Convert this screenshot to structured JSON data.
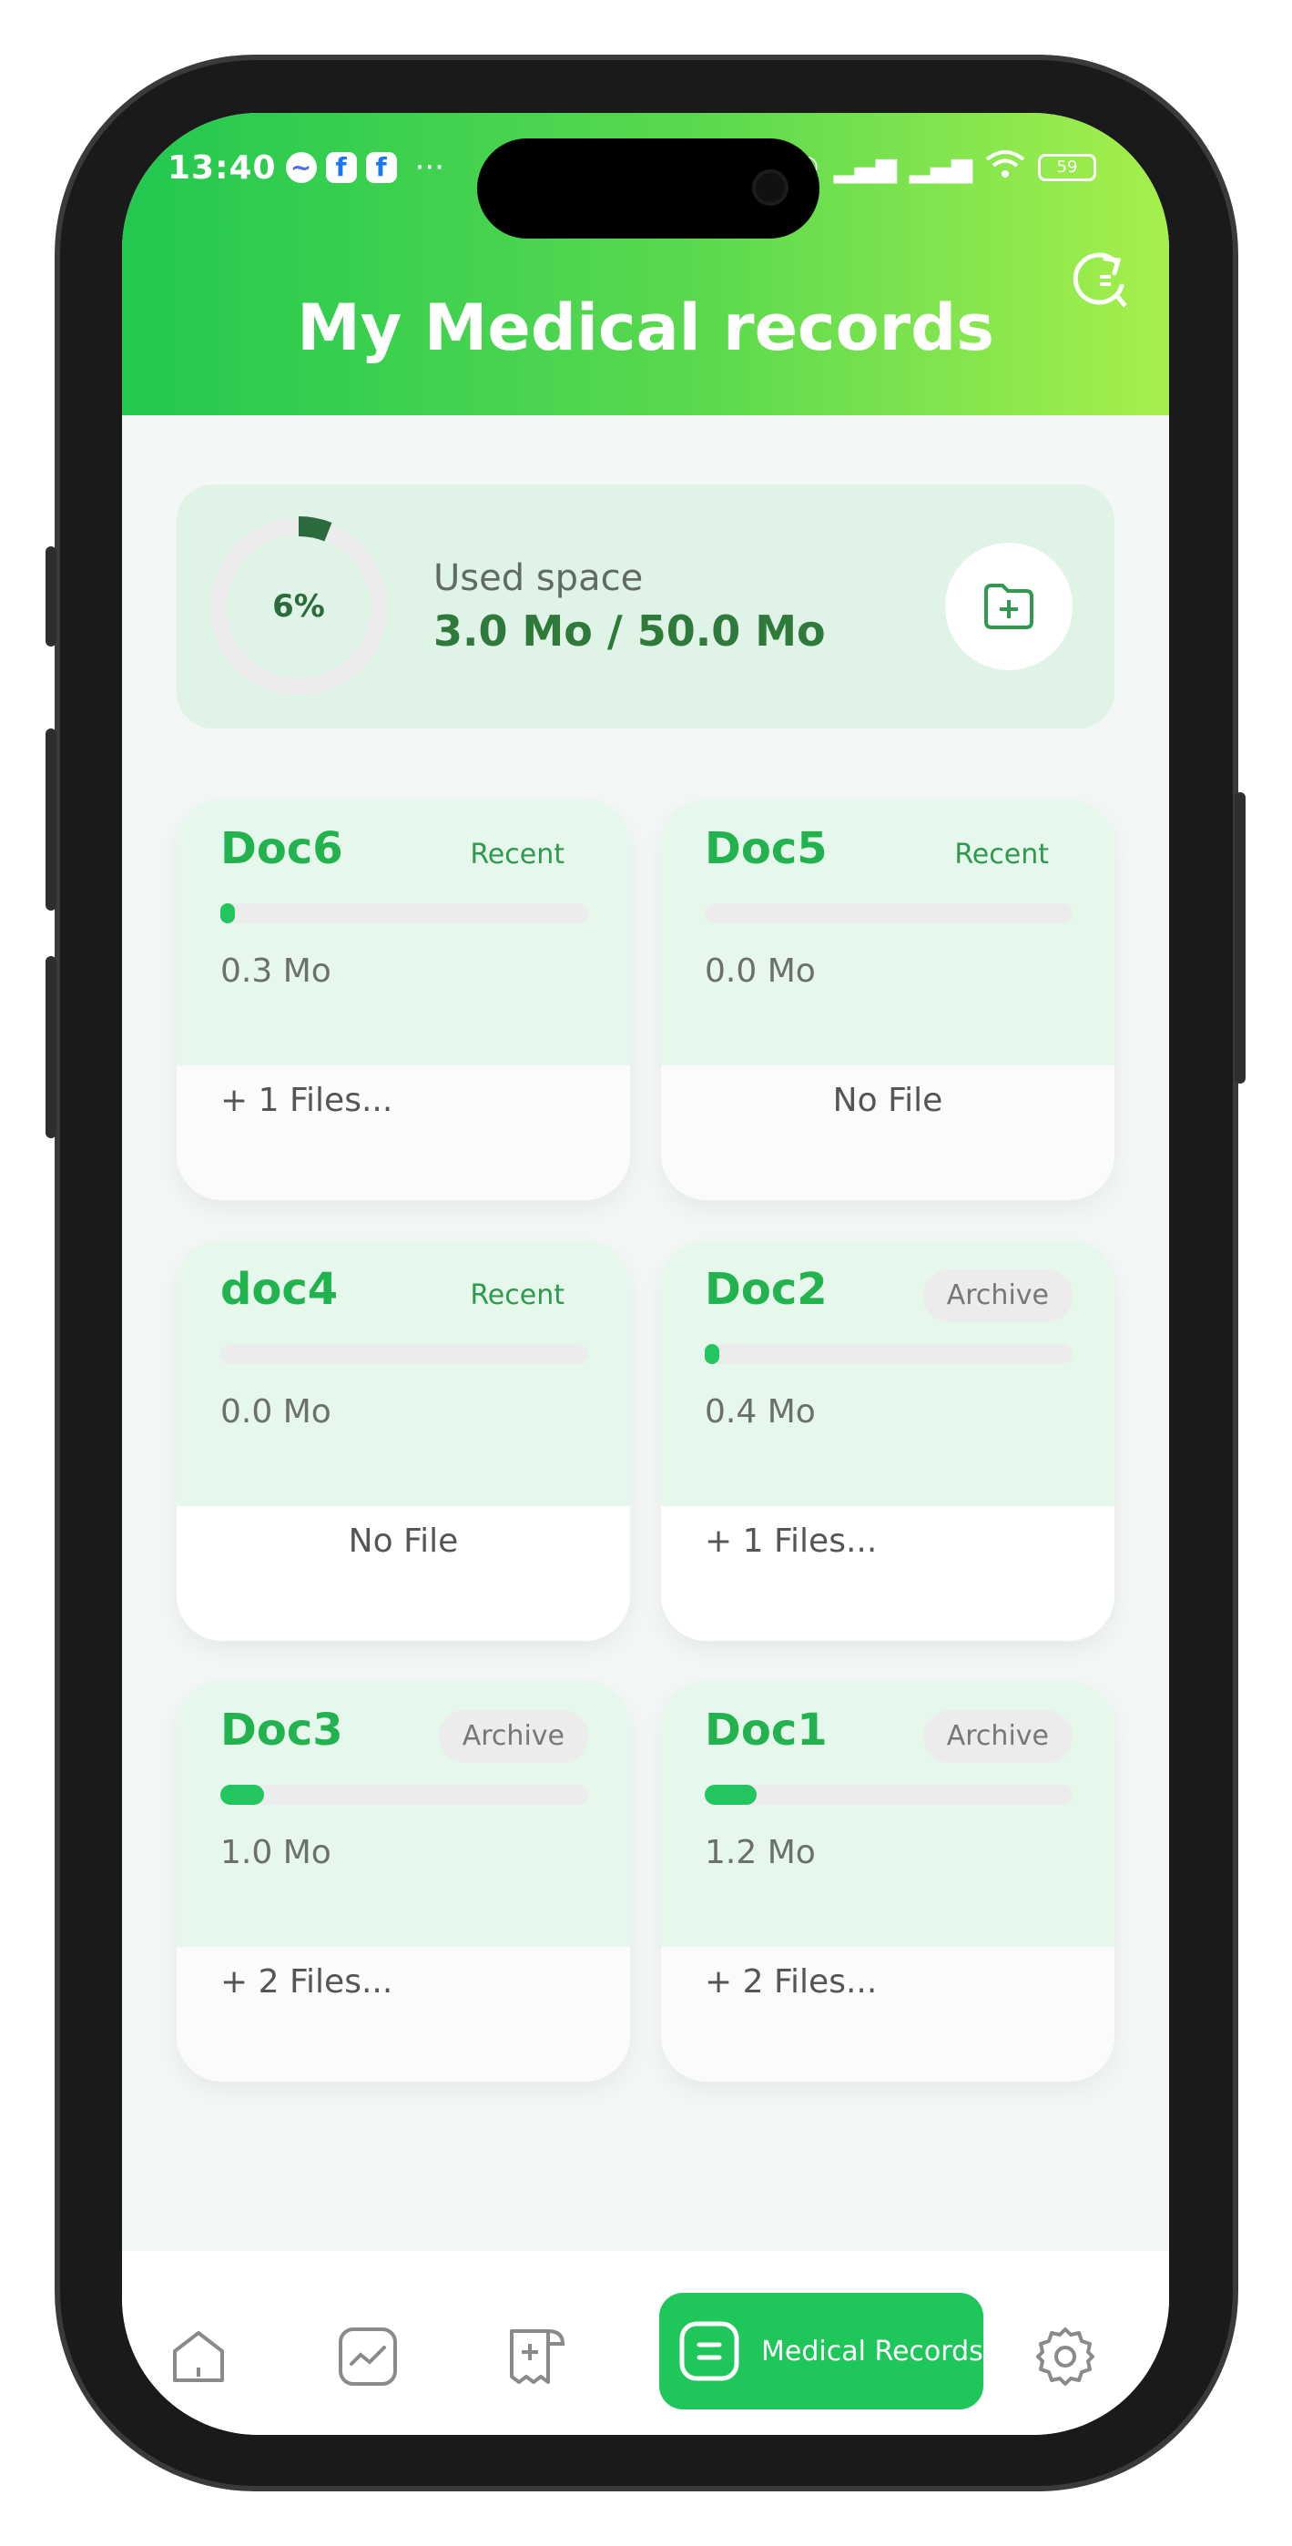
{
  "status_bar": {
    "time": "13:40",
    "battery": "59"
  },
  "header": {
    "title": "My Medical records"
  },
  "storage": {
    "percent_label": "6%",
    "percent": 0.06,
    "used_label": "Used space",
    "used_value": "3.0 Mo / 50.0 Mo"
  },
  "cards": [
    {
      "name": "Doc6",
      "badge": "Recent",
      "size": "0.3 Mo",
      "progress": 0.02,
      "files": "+ 1 Files..."
    },
    {
      "name": "Doc5",
      "badge": "Recent",
      "size": "0.0 Mo",
      "progress": 0.0,
      "files": "No File"
    },
    {
      "name": "doc4",
      "badge": "Recent",
      "size": "0.0 Mo",
      "progress": 0.0,
      "files": "No File"
    },
    {
      "name": "Doc2",
      "badge": "Archive",
      "size": "0.4 Mo",
      "progress": 0.03,
      "files": "+ 1 Files..."
    },
    {
      "name": "Doc3",
      "badge": "Archive",
      "size": "1.0 Mo",
      "progress": 0.12,
      "files": "+ 2 Files..."
    },
    {
      "name": "Doc1",
      "badge": "Archive",
      "size": "1.2 Mo",
      "progress": 0.14,
      "files": "+ 2 Files..."
    }
  ],
  "nav": {
    "active_label": "Medical Records"
  },
  "colors": {
    "accent": "#1fc65a",
    "header_start": "#22c84f",
    "header_end": "#a6ef4c",
    "title_green": "#22b34e"
  }
}
